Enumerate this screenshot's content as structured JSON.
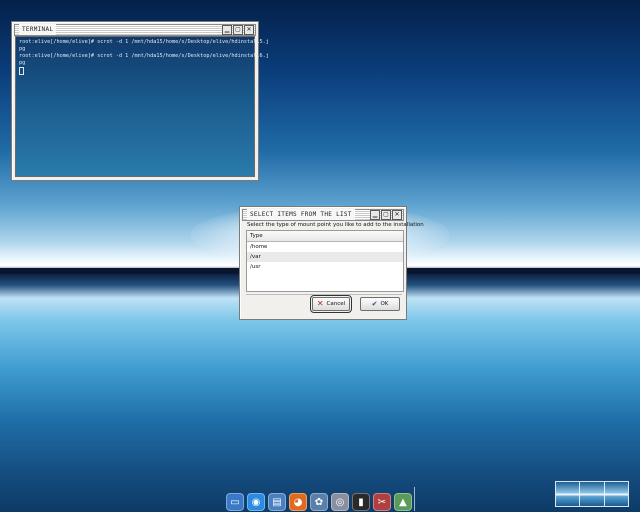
{
  "terminal": {
    "title": "TERMINAL",
    "lines": [
      "root:elive[/home/elive]# scrot -d 1 /mnt/hda15/home/s/Desktop/elive/hdinstall5.j",
      "pg",
      "root:elive[/home/elive]# scrot -d 1 /mnt/hda15/home/s/Desktop/elive/hdinstall6.j",
      "pg"
    ]
  },
  "dialog": {
    "title": "SELECT ITEMS FROM THE LIST",
    "prompt": "Select the type of mount point you like to add to the installation",
    "list_header": "Type",
    "items": [
      "/home",
      "/var",
      "/usr"
    ],
    "selected_index": 1,
    "cancel_label": "Cancel",
    "ok_label": "OK"
  },
  "titlebar_buttons": [
    "▁",
    "▢",
    "✕"
  ],
  "dock": {
    "icons": [
      {
        "name": "monitor-icon",
        "glyph": "▭",
        "color": "#3a78c8"
      },
      {
        "name": "globe-icon",
        "glyph": "◉",
        "color": "#2a8be0"
      },
      {
        "name": "files-icon",
        "glyph": "▤",
        "color": "#4a7fc0"
      },
      {
        "name": "firefox-icon",
        "glyph": "◕",
        "color": "#e06a1e"
      },
      {
        "name": "settings-icon",
        "glyph": "✿",
        "color": "#5a7fa8"
      },
      {
        "name": "media-icon",
        "glyph": "◎",
        "color": "#8a8fa0"
      },
      {
        "name": "terminal-icon",
        "glyph": "▮",
        "color": "#2a2a2a"
      },
      {
        "name": "tools-icon",
        "glyph": "✂",
        "color": "#b04040"
      },
      {
        "name": "installer-icon",
        "glyph": "▲",
        "color": "#5a9a5a"
      }
    ]
  }
}
